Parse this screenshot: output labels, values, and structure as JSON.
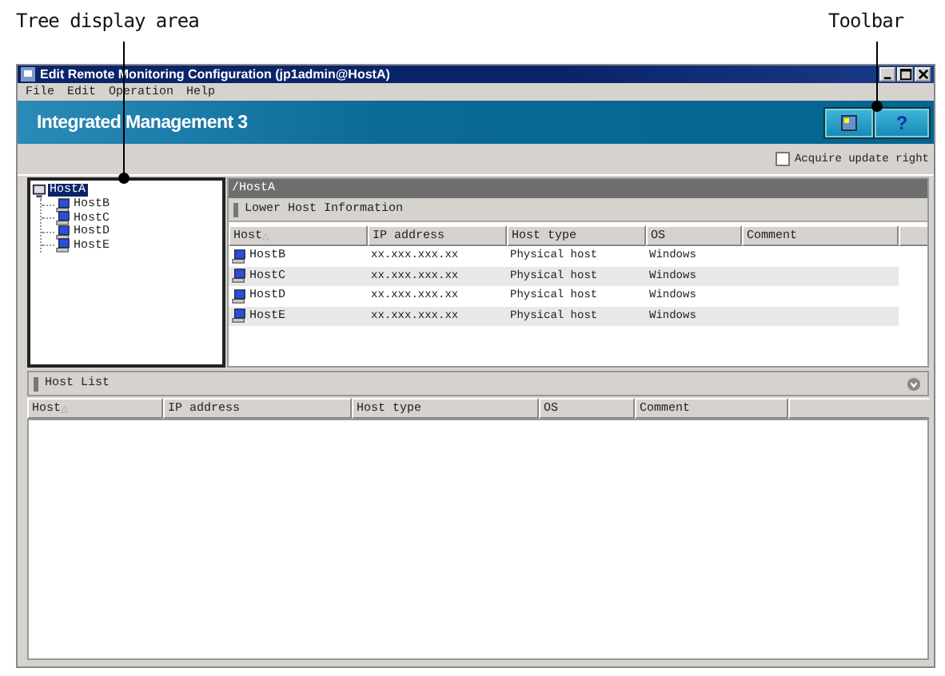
{
  "callouts": [
    {
      "label": "Tree display area"
    },
    {
      "label": "Toolbar"
    }
  ],
  "window": {
    "title": "Edit Remote Monitoring Configuration (jp1admin@HostA)"
  },
  "menu": [
    "File",
    "Edit",
    "Operation",
    "Help"
  ],
  "banner": {
    "title": "Integrated Management 3",
    "help_button": "?"
  },
  "acquire_update_right": {
    "label": "Acquire update right",
    "checked": false
  },
  "tree": {
    "label": "HostA",
    "selected": true,
    "children": [
      {
        "label": "HostB",
        "selected": false
      },
      {
        "label": "HostC",
        "selected": false
      },
      {
        "label": "HostD",
        "selected": false
      },
      {
        "label": "HostE",
        "selected": false
      }
    ]
  },
  "path": "/HostA",
  "lower_host_information": {
    "title": "Lower Host Information",
    "columns": [
      {
        "label": "Host",
        "sort_mark": "△"
      },
      {
        "label": "IP address"
      },
      {
        "label": "Host type"
      },
      {
        "label": "OS"
      },
      {
        "label": "Comment"
      }
    ],
    "rows": [
      [
        "HostB",
        "xx.xxx.xxx.xx",
        "Physical host",
        "Windows",
        ""
      ],
      [
        "HostC",
        "xx.xxx.xxx.xx",
        "Physical host",
        "Windows",
        ""
      ],
      [
        "HostD",
        "xx.xxx.xxx.xx",
        "Physical host",
        "Windows",
        ""
      ],
      [
        "HostE",
        "xx.xxx.xxx.xx",
        "Physical host",
        "Windows",
        ""
      ]
    ]
  },
  "host_list": {
    "title": "Host List",
    "columns": [
      {
        "label": "Host",
        "sort_mark": "△"
      },
      {
        "label": "IP address"
      },
      {
        "label": "Host type"
      },
      {
        "label": "OS"
      },
      {
        "label": "Comment"
      }
    ]
  }
}
